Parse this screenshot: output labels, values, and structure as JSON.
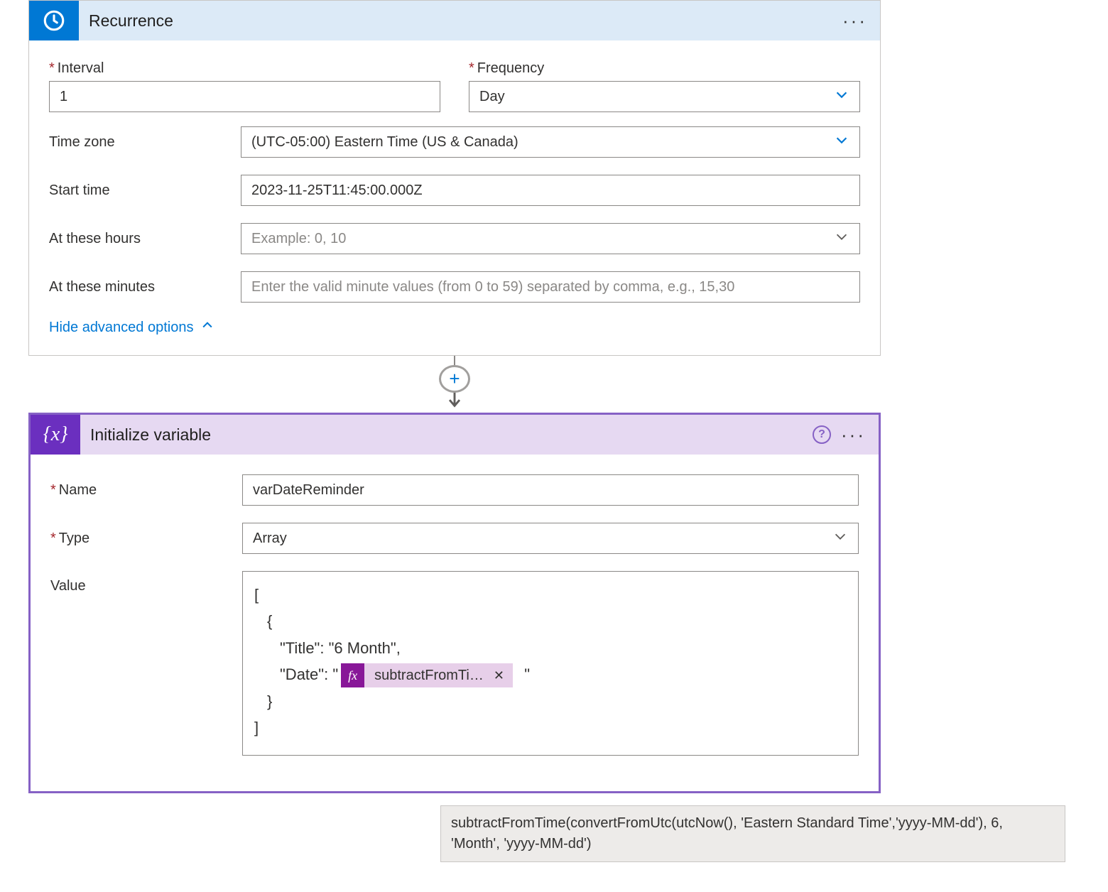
{
  "recurrence": {
    "title": "Recurrence",
    "interval_label": "Interval",
    "interval_value": "1",
    "frequency_label": "Frequency",
    "frequency_value": "Day",
    "timezone_label": "Time zone",
    "timezone_value": "(UTC-05:00) Eastern Time (US & Canada)",
    "starttime_label": "Start time",
    "starttime_value": "2023-11-25T11:45:00.000Z",
    "hours_label": "At these hours",
    "hours_placeholder": "Example: 0, 10",
    "minutes_label": "At these minutes",
    "minutes_placeholder": "Enter the valid minute values (from 0 to 59) separated by comma, e.g., 15,30",
    "hide_advanced": "Hide advanced options"
  },
  "init": {
    "title": "Initialize variable",
    "name_label": "Name",
    "name_value": "varDateReminder",
    "type_label": "Type",
    "type_value": "Array",
    "value_label": "Value",
    "json_open": "[",
    "brace_open": "{",
    "title_line": "\"Title\": \"6 Month\",",
    "date_prefix": "\"Date\": \"",
    "date_suffix": "\"",
    "brace_close": "}",
    "json_close": "]",
    "fx_badge": "fx",
    "fx_text": "subtractFromTi…",
    "fx_close": "✕"
  },
  "tooltip": "subtractFromTime(convertFromUtc(utcNow(), 'Eastern Standard Time','yyyy-MM-dd'), 6, 'Month', 'yyyy-MM-dd')",
  "icons": {
    "help": "?",
    "plus": "+"
  }
}
